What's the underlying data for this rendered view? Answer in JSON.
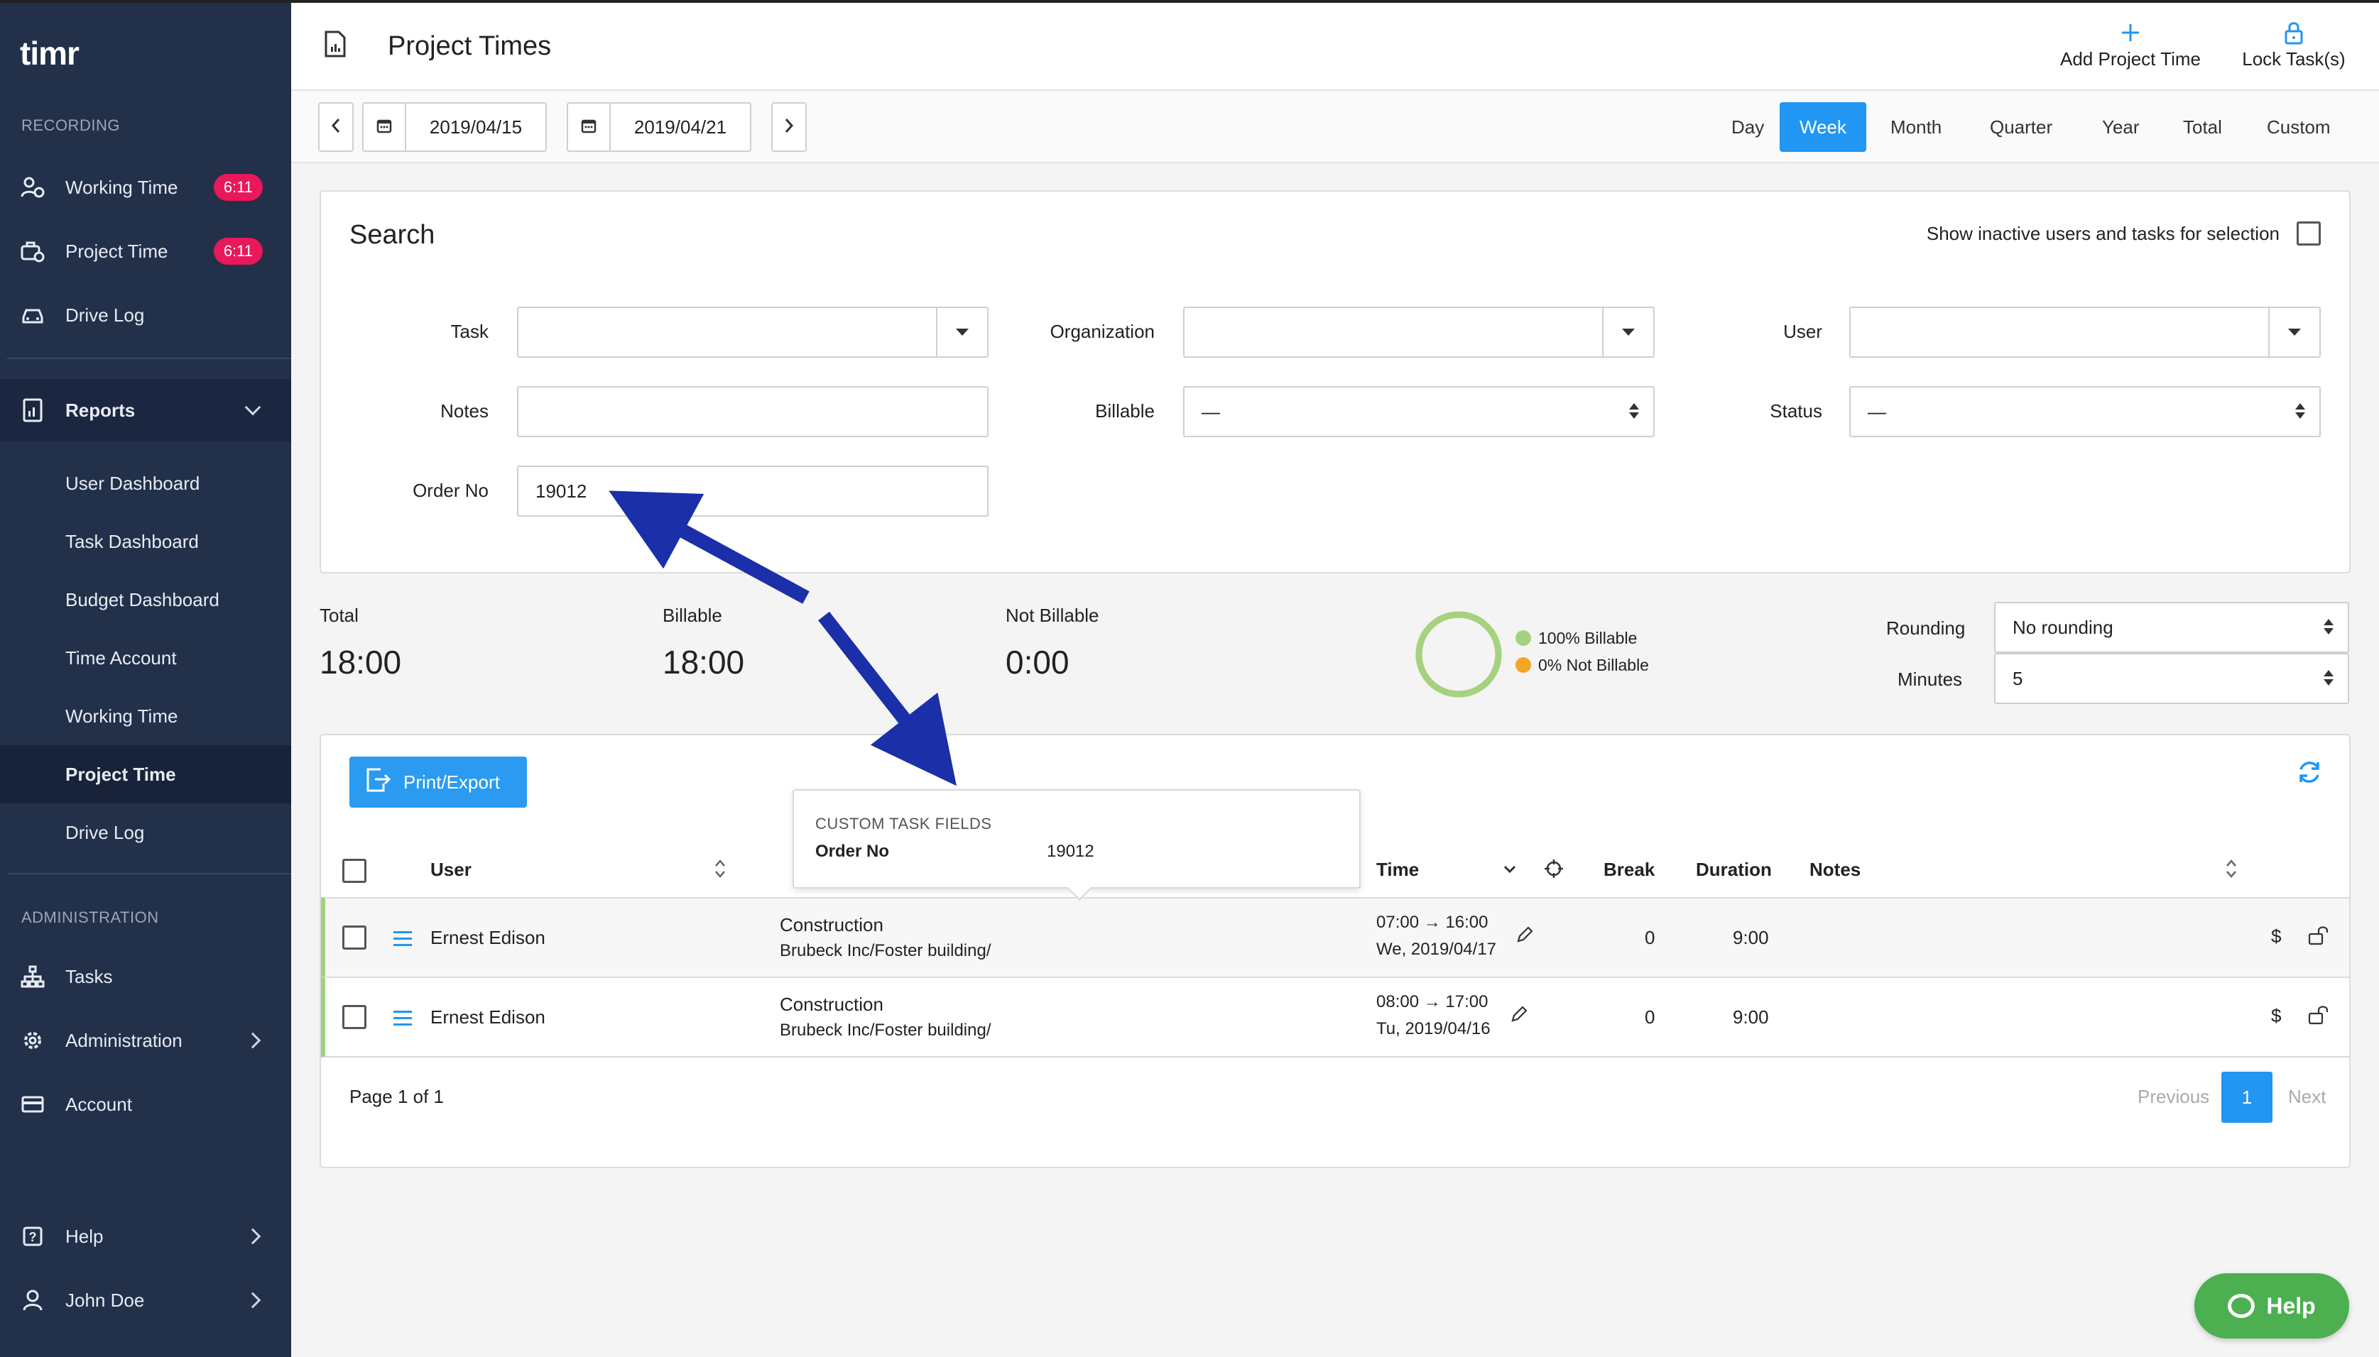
{
  "app": {
    "logo_text": "timr"
  },
  "sidebar": {
    "recording_label": "RECORDING",
    "recording_items": [
      {
        "label": "Working Time",
        "badge": "6:11",
        "icon": "user-clock-icon"
      },
      {
        "label": "Project Time",
        "badge": "6:11",
        "icon": "briefcase-clock-icon"
      },
      {
        "label": "Drive Log",
        "icon": "car-icon"
      }
    ],
    "reports": {
      "label": "Reports",
      "icon": "report-icon",
      "items": [
        {
          "label": "User Dashboard"
        },
        {
          "label": "Task Dashboard"
        },
        {
          "label": "Budget Dashboard"
        },
        {
          "label": "Time Account"
        },
        {
          "label": "Working Time"
        },
        {
          "label": "Project Time",
          "active": true
        },
        {
          "label": "Drive Log"
        }
      ]
    },
    "administration_label": "ADMINISTRATION",
    "admin_items": [
      {
        "label": "Tasks",
        "icon": "hierarchy-icon"
      },
      {
        "label": "Administration",
        "icon": "gear-icon"
      },
      {
        "label": "Account",
        "icon": "credit-card-icon"
      }
    ],
    "bottom_items": [
      {
        "label": "Help",
        "icon": "question-icon"
      },
      {
        "label": "John Doe",
        "icon": "user-icon"
      }
    ]
  },
  "header": {
    "title": "Project Times",
    "add_project_time": "Add Project Time",
    "lock_tasks": "Lock Task(s)"
  },
  "datebar": {
    "start_date": "2019/04/15",
    "end_date": "2019/04/21",
    "periods": [
      "Day",
      "Week",
      "Month",
      "Quarter",
      "Year",
      "Total",
      "Custom"
    ],
    "active_period": "Week"
  },
  "search": {
    "title": "Search",
    "show_inactive_label": "Show inactive users and tasks for selection",
    "labels": {
      "task": "Task",
      "organization": "Organization",
      "user": "User",
      "notes": "Notes",
      "billable": "Billable",
      "status": "Status",
      "order_no": "Order No"
    },
    "values": {
      "task": "",
      "organization": "",
      "user": "",
      "notes": "",
      "billable": "—",
      "status": "—",
      "order_no": "19012"
    }
  },
  "summary": {
    "total_label": "Total",
    "total_value": "18:00",
    "billable_label": "Billable",
    "billable_value": "18:00",
    "not_billable_label": "Not Billable",
    "not_billable_value": "0:00",
    "legend_billable": "100% Billable",
    "legend_not_billable": "0% Not Billable",
    "billable_fraction": 1.0,
    "colors": {
      "billable": "#a5d27f",
      "not_billable": "#f5a623"
    },
    "rounding_label": "Rounding",
    "rounding_value": "No rounding",
    "minutes_label": "Minutes",
    "minutes_value": "5"
  },
  "table": {
    "print_export": "Print/Export",
    "columns": {
      "user": "User",
      "time": "Time",
      "break": "Break",
      "duration": "Duration",
      "notes": "Notes"
    },
    "tooltip": {
      "heading": "CUSTOM TASK FIELDS",
      "field": "Order No",
      "value": "19012"
    },
    "rows": [
      {
        "user": "Ernest Edison",
        "task": "Construction",
        "path": "Brubeck Inc/Foster building/",
        "time_range": "07:00 → 16:00",
        "date": "We, 2019/04/17",
        "break": "0",
        "duration": "9:00"
      },
      {
        "user": "Ernest Edison",
        "task": "Construction",
        "path": "Brubeck Inc/Foster building/",
        "time_range": "08:00 → 17:00",
        "date": "Tu, 2019/04/16",
        "break": "0",
        "duration": "9:00"
      }
    ],
    "page_info": "Page 1 of 1",
    "previous": "Previous",
    "next": "Next",
    "current_page": "1"
  },
  "help_button": "Help",
  "colors": {
    "sidebar_bg": "#22304a",
    "accent": "#2196f3",
    "badge": "#e8185b",
    "help_green": "#4caf50",
    "annotation_arrow": "#1a2fa8"
  }
}
